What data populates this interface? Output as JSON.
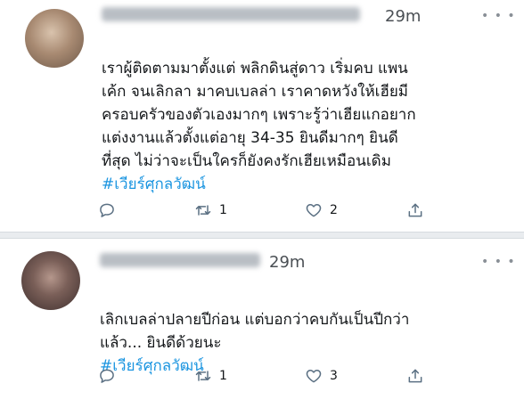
{
  "tweets": [
    {
      "time": "29m",
      "more": "• • •",
      "text": "เราผู้ติดตามมาตั้งแต่ พลิกดินสู่ดาว เริ่มคบ แพน\nเค้ก จนเลิกลา มาคบเบลล่า เราคาดหวังให้เฮียมี\nครอบครัวของตัวเองมากๆ เพราะรู้ว่าเฮียแกอยาก\nแต่งงานแล้วตั้งแต่อายุ 34-35  ยินดีมากๆ ยินดี\nที่สุด ไม่ว่าจะเป็นใครก็ยังคงรักเฮียเหมือนเดิม",
      "hashtag": "#เวียร์ศุกลวัฒน์",
      "retweets": "1",
      "likes": "2"
    },
    {
      "time": "29m",
      "more": "• • •",
      "text": "เลิกเบลล่าปลายปีก่อน แต่บอกว่าคบกันเป็นปีกว่า\nแล้ว... ยินดีด้วยนะ",
      "hashtag": "#เวียร์ศุกลวัฒน์",
      "retweets": "1",
      "likes": "3"
    }
  ],
  "icons": {
    "reply": "reply-icon",
    "retweet": "retweet-icon",
    "like": "heart-icon",
    "share": "share-icon"
  },
  "colors": {
    "hashtag": "#1b95e0",
    "icon": "#5b7083",
    "separator": "#e9ecef"
  }
}
